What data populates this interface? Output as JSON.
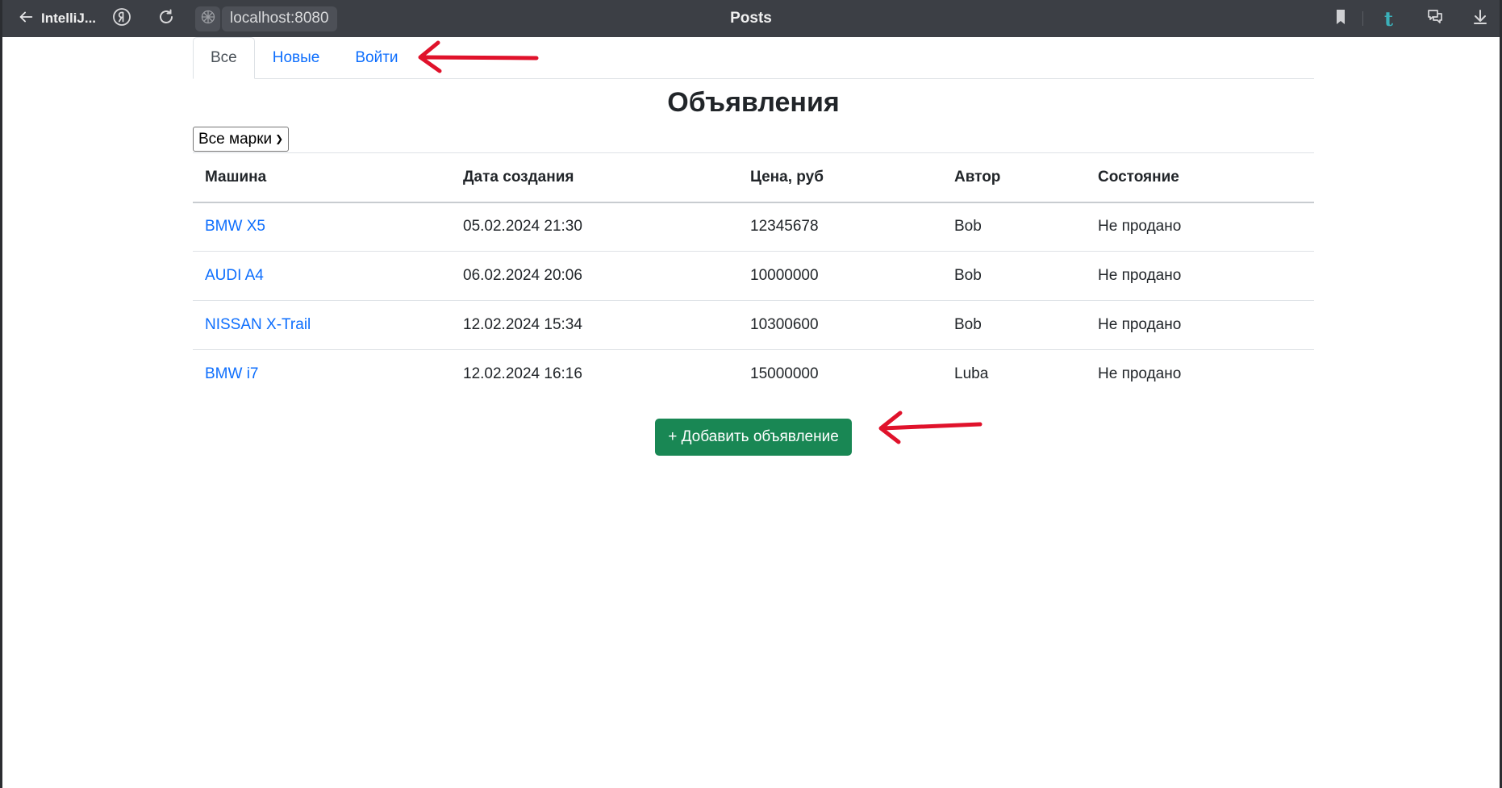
{
  "browser": {
    "back_label": "IntelliJ...",
    "address": "localhost:8080",
    "tab_title": "Posts",
    "extension_glyph": "t"
  },
  "nav": {
    "tabs": [
      {
        "label": "Все",
        "active": true
      },
      {
        "label": "Новые",
        "active": false
      },
      {
        "label": "Войти",
        "active": false
      }
    ]
  },
  "page": {
    "title": "Объявления",
    "filter_selected": "Все марки"
  },
  "table": {
    "headers": [
      "Машина",
      "Дата создания",
      "Цена, руб",
      "Автор",
      "Состояние"
    ],
    "rows": [
      {
        "car": "BMW X5",
        "created": "05.02.2024 21:30",
        "price": "12345678",
        "author": "Bob",
        "status": "Не продано"
      },
      {
        "car": "AUDI A4",
        "created": "06.02.2024 20:06",
        "price": "10000000",
        "author": "Bob",
        "status": "Не продано"
      },
      {
        "car": "NISSAN X-Trail",
        "created": "12.02.2024 15:34",
        "price": "10300600",
        "author": "Bob",
        "status": "Не продано"
      },
      {
        "car": "BMW i7",
        "created": "12.02.2024 16:16",
        "price": "15000000",
        "author": "Luba",
        "status": "Не продано"
      }
    ]
  },
  "actions": {
    "add_label": "+ Добавить объявление"
  },
  "colors": {
    "link": "#0d6efd",
    "success": "#198754",
    "annotation": "#e0122b",
    "browser_bar": "#3c3f45"
  }
}
